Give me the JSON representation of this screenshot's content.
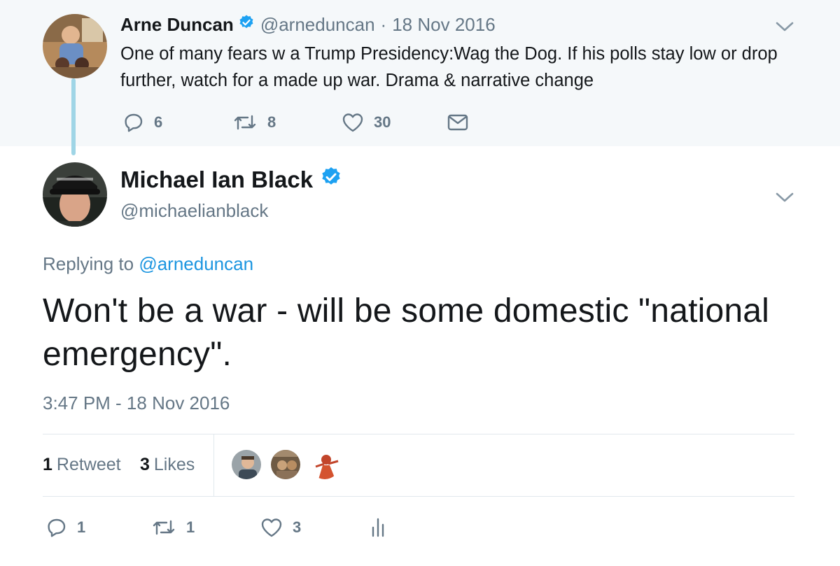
{
  "parent_tweet": {
    "name": "Arne Duncan",
    "handle": "@arneduncan",
    "separator": "·",
    "date": "18 Nov 2016",
    "text": "One of many fears w a Trump Presidency:Wag the Dog. If his polls stay low or drop further, watch for a made up war. Drama & narrative change",
    "actions": {
      "replies": "6",
      "retweets": "8",
      "likes": "30"
    },
    "icons": [
      "reply-icon",
      "retweet-icon",
      "like-icon",
      "message-icon",
      "chevron-down-icon",
      "verified-icon"
    ]
  },
  "main_tweet": {
    "name": "Michael Ian Black",
    "handle": "@michaelianblack",
    "replying_prefix": "Replying to",
    "replying_to": "@arneduncan",
    "text": "Won't be a war - will be some domestic \"national emergency\".",
    "timestamp": "3:47 PM - 18 Nov 2016",
    "stats": {
      "retweet_count": "1",
      "retweet_label": "Retweet",
      "like_count": "3",
      "like_label": "Likes"
    },
    "actions": {
      "replies": "1",
      "retweets": "1",
      "likes": "3"
    },
    "icons": [
      "reply-icon",
      "retweet-icon",
      "like-icon",
      "analytics-icon",
      "chevron-down-icon",
      "verified-icon"
    ]
  },
  "colors": {
    "accent": "#1b95e0",
    "verified": "#1da1f2",
    "muted": "#657786",
    "text": "#14171a",
    "parent_bg": "#f5f8fa",
    "thread_line": "#9fd5e6"
  }
}
